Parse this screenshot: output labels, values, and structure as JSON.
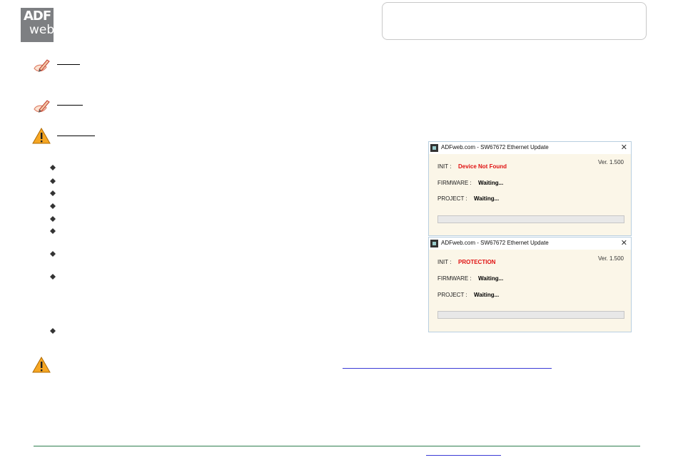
{
  "brand": {
    "logo_text_top": "ADF",
    "logo_text_bottom": "web"
  },
  "dialogs": [
    {
      "title": "ADFweb.com - SW67672 Ethernet Update",
      "version": "Ver. 1.500",
      "init_label": "INIT :",
      "init_value": "Device Not Found",
      "firmware_label": "FIRMWARE :",
      "firmware_value": "Waiting...",
      "project_label": "PROJECT :",
      "project_value": "Waiting...",
      "close_glyph": "✕",
      "progress": 0
    },
    {
      "title": "ADFweb.com - SW67672 Ethernet Update",
      "version": "Ver. 1.500",
      "init_label": "INIT :",
      "init_value": "PROTECTION",
      "firmware_label": "FIRMWARE :",
      "firmware_value": "Waiting...",
      "project_label": "PROJECT :",
      "project_value": "Waiting...",
      "close_glyph": "✕",
      "progress": 0
    }
  ],
  "icons": {
    "note": "pencil-note-icon",
    "warning": "warning-triangle-icon",
    "bullet": "bullet-icon"
  },
  "colors": {
    "error_text": "#e01010",
    "dialog_background": "#fbf6e8",
    "footer_line": "#2e7d4f",
    "link": "#3b3bd6"
  }
}
